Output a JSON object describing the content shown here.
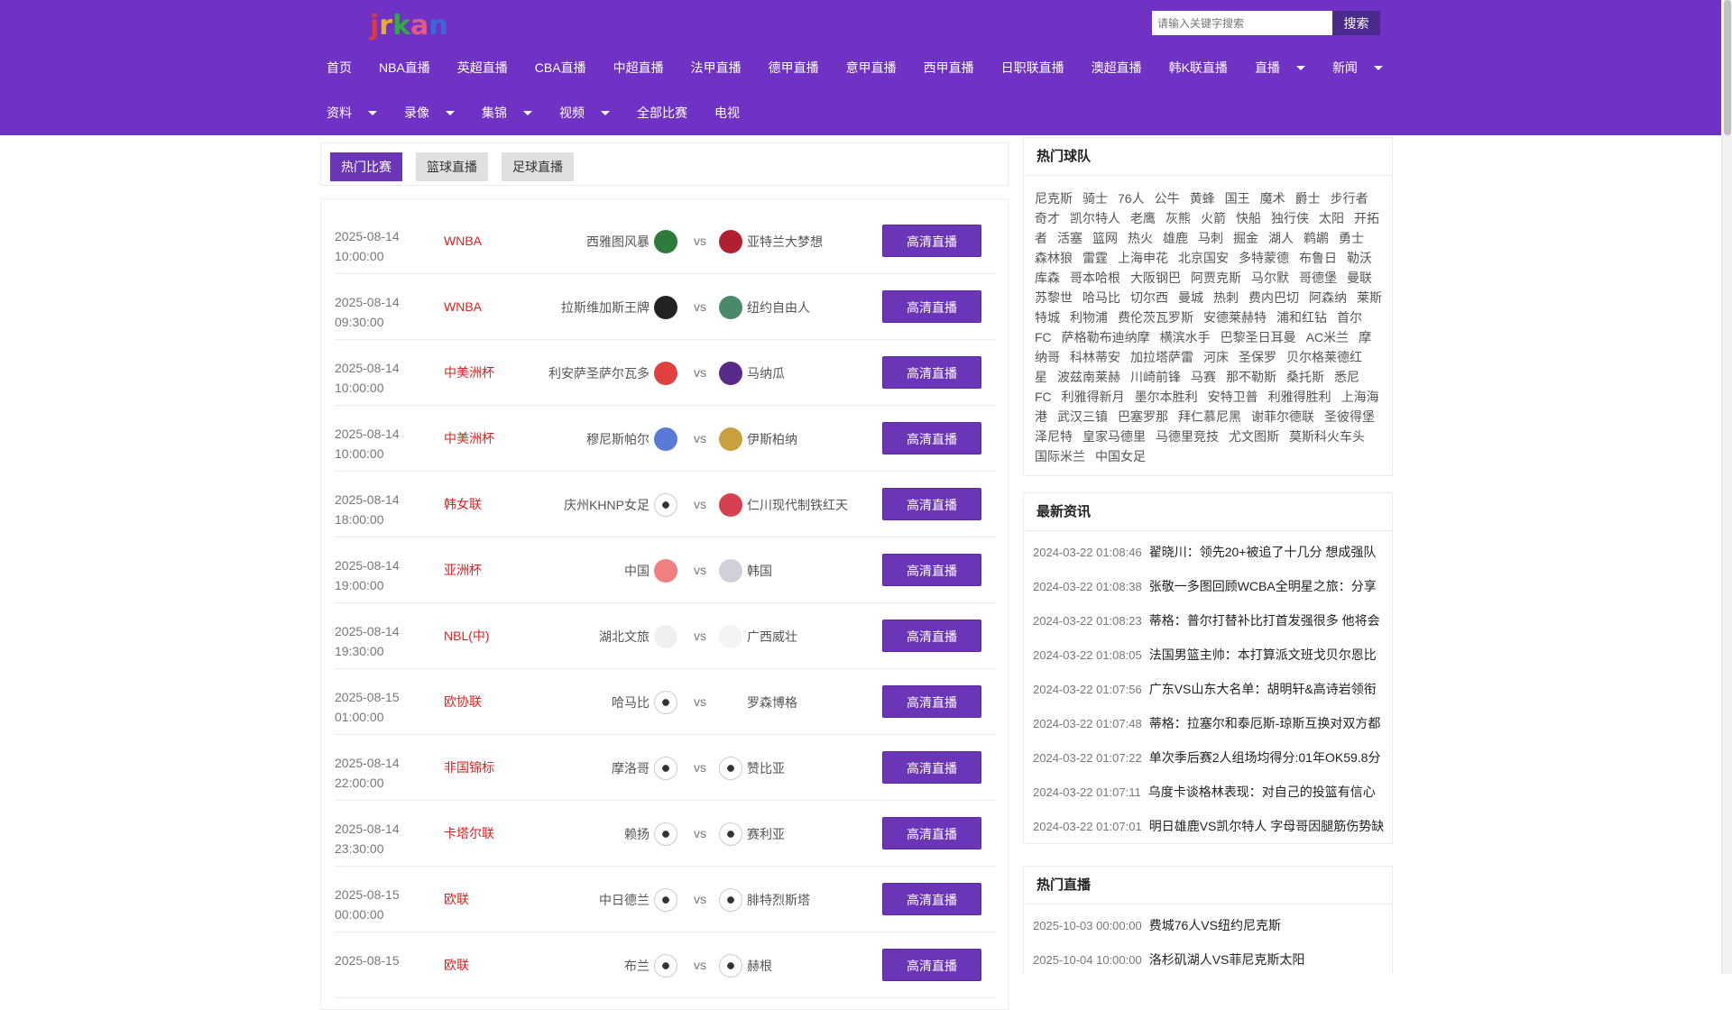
{
  "logo": {
    "letters": [
      "j",
      "r",
      "k",
      "a",
      "n"
    ],
    "colors": [
      "#e03a3a",
      "#e8b020",
      "#35a84a",
      "#e05a8a",
      "#3a6ad8"
    ]
  },
  "search": {
    "placeholder": "请输入关键字搜索",
    "button": "搜索"
  },
  "nav1": [
    {
      "label": "首页",
      "dropdown": false
    },
    {
      "label": "NBA直播",
      "dropdown": false
    },
    {
      "label": "英超直播",
      "dropdown": false
    },
    {
      "label": "CBA直播",
      "dropdown": false
    },
    {
      "label": "中超直播",
      "dropdown": false
    },
    {
      "label": "法甲直播",
      "dropdown": false
    },
    {
      "label": "德甲直播",
      "dropdown": false
    },
    {
      "label": "意甲直播",
      "dropdown": false
    },
    {
      "label": "西甲直播",
      "dropdown": false
    },
    {
      "label": "日职联直播",
      "dropdown": false
    },
    {
      "label": "澳超直播",
      "dropdown": false
    },
    {
      "label": "韩K联直播",
      "dropdown": false
    },
    {
      "label": "直播",
      "dropdown": true
    },
    {
      "label": "新闻",
      "dropdown": true
    }
  ],
  "nav2": [
    {
      "label": "资料",
      "dropdown": true
    },
    {
      "label": "录像",
      "dropdown": true
    },
    {
      "label": "集锦",
      "dropdown": true
    },
    {
      "label": "视频",
      "dropdown": true
    },
    {
      "label": "全部比赛",
      "dropdown": false
    },
    {
      "label": "电视",
      "dropdown": false
    }
  ],
  "tabs": [
    "热门比赛",
    "篮球直播",
    "足球直播"
  ],
  "watch_label": "高清直播",
  "vs_label": "vs",
  "matches": [
    {
      "date": "2025-08-14",
      "time": "10:00:00",
      "league": "WNBA",
      "home": "西雅图风暴",
      "away": "亚特兰大梦想",
      "home_color": "#2e7a3a",
      "away_color": "#b02030"
    },
    {
      "date": "2025-08-14",
      "time": "09:30:00",
      "league": "WNBA",
      "home": "拉斯维加斯王牌",
      "away": "纽约自由人",
      "home_color": "#222222",
      "away_color": "#4a8a6a"
    },
    {
      "date": "2025-08-14",
      "time": "10:00:00",
      "league": "中美洲杯",
      "home": "利安萨圣萨尔瓦多",
      "away": "马纳瓜",
      "home_color": "#e04040",
      "away_color": "#5a2a8a"
    },
    {
      "date": "2025-08-14",
      "time": "10:00:00",
      "league": "中美洲杯",
      "home": "穆尼斯帕尔",
      "away": "伊斯柏纳",
      "home_color": "#5a7ad8",
      "away_color": "#c8a040"
    },
    {
      "date": "2025-08-14",
      "time": "18:00:00",
      "league": "韩女联",
      "home": "庆州KHNP女足",
      "away": "仁川现代制铁红天",
      "home_color": "ball",
      "away_color": "#d84050"
    },
    {
      "date": "2025-08-14",
      "time": "19:00:00",
      "league": "亚洲杯",
      "home": "中国",
      "away": "韩国",
      "home_color": "#f08080",
      "away_color": "#d0d0d8"
    },
    {
      "date": "2025-08-14",
      "time": "19:30:00",
      "league": "NBL(中)",
      "home": "湖北文旅",
      "away": "广西威壮",
      "home_color": "#f0f0f0",
      "away_color": "#f4f4f4"
    },
    {
      "date": "2025-08-15",
      "time": "01:00:00",
      "league": "欧协联",
      "home": "哈马比",
      "away": "罗森博格",
      "home_color": "ball",
      "away_color": "none"
    },
    {
      "date": "2025-08-14",
      "time": "22:00:00",
      "league": "非国锦标",
      "home": "摩洛哥",
      "away": "赞比亚",
      "home_color": "ball",
      "away_color": "ball"
    },
    {
      "date": "2025-08-14",
      "time": "23:30:00",
      "league": "卡塔尔联",
      "home": "赖扬",
      "away": "赛利亚",
      "home_color": "ball",
      "away_color": "ball"
    },
    {
      "date": "2025-08-15",
      "time": "00:00:00",
      "league": "欧联",
      "home": "中日德兰",
      "away": "腓特烈斯塔",
      "home_color": "ball",
      "away_color": "ball"
    },
    {
      "date": "2025-08-15",
      "time": "",
      "league": "欧联",
      "home": "布兰",
      "away": "赫根",
      "home_color": "ball",
      "away_color": "ball"
    }
  ],
  "hot_teams": {
    "title": "热门球队",
    "items": [
      "尼克斯",
      "骑士",
      "76人",
      "公牛",
      "黄蜂",
      "国王",
      "魔术",
      "爵士",
      "步行者",
      "奇才",
      "凯尔特人",
      "老鹰",
      "灰熊",
      "火箭",
      "快船",
      "独行侠",
      "太阳",
      "开拓者",
      "活塞",
      "篮网",
      "热火",
      "雄鹿",
      "马刺",
      "掘金",
      "湖人",
      "鹈鹕",
      "勇士",
      "森林狼",
      "雷霆",
      "上海申花",
      "北京国安",
      "多特蒙德",
      "布鲁日",
      "勒沃库森",
      "哥本哈根",
      "大阪钢巴",
      "阿贾克斯",
      "马尔默",
      "哥德堡",
      "曼联",
      "苏黎世",
      "哈马比",
      "切尔西",
      "曼城",
      "热刺",
      "费内巴切",
      "阿森纳",
      "莱斯特城",
      "利物浦",
      "费伦茨瓦罗斯",
      "安德莱赫特",
      "浦和红钻",
      "首尔FC",
      "萨格勒布迪纳摩",
      "横滨水手",
      "巴黎圣日耳曼",
      "AC米兰",
      "摩纳哥",
      "科林蒂安",
      "加拉塔萨雷",
      "河床",
      "圣保罗",
      "贝尔格莱德红星",
      "波兹南莱赫",
      "川崎前锋",
      "马赛",
      "那不勒斯",
      "桑托斯",
      "悉尼FC",
      "利雅得新月",
      "墨尔本胜利",
      "安特卫普",
      "利雅得胜利",
      "上海海港",
      "武汉三镇",
      "巴塞罗那",
      "拜仁慕尼黑",
      "谢菲尔德联",
      "圣彼得堡泽尼特",
      "皇家马德里",
      "马德里竞技",
      "尤文图斯",
      "莫斯科火车头",
      "国际米兰",
      "中国女足"
    ]
  },
  "latest_news": {
    "title": "最新资讯",
    "items": [
      {
        "time": "2024-03-22 01:08:46",
        "title": "翟晓川：领先20+被追了十几分 想成强队"
      },
      {
        "time": "2024-03-22 01:08:38",
        "title": "张敬一多图回顾WCBA全明星之旅：分享"
      },
      {
        "time": "2024-03-22 01:08:23",
        "title": "蒂格：普尔打替补比打首发强很多 他将会"
      },
      {
        "time": "2024-03-22 01:08:05",
        "title": "法国男篮主帅：本打算派文班戈贝尔恩比"
      },
      {
        "time": "2024-03-22 01:07:56",
        "title": "广东VS山东大名单：胡明轩&高诗岩领衔"
      },
      {
        "time": "2024-03-22 01:07:48",
        "title": "蒂格：拉塞尔和泰厄斯-琼斯互换对双方都"
      },
      {
        "time": "2024-03-22 01:07:22",
        "title": "单次季后赛2人组场均得分:01年OK59.8分"
      },
      {
        "time": "2024-03-22 01:07:11",
        "title": "乌度卡谈格林表现：对自己的投篮有信心"
      },
      {
        "time": "2024-03-22 01:07:01",
        "title": "明日雄鹿VS凯尔特人 字母哥因腿筋伤势缺"
      }
    ]
  },
  "hot_live": {
    "title": "热门直播",
    "items": [
      {
        "time": "2025-10-03 00:00:00",
        "title": "费城76人VS纽约尼克斯"
      },
      {
        "time": "2025-10-04 10:00:00",
        "title": "洛杉矶湖人VS菲尼克斯太阳"
      }
    ]
  }
}
